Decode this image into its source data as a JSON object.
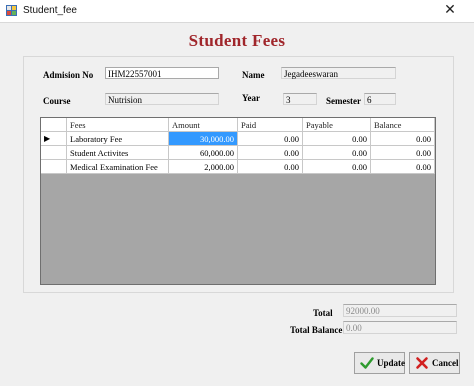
{
  "window": {
    "title": "Student_fee",
    "close_glyph": "✕"
  },
  "heading": "Student Fees",
  "form": {
    "admission_label": "Admision No",
    "admission_value": "IHM22557001",
    "name_label": "Name",
    "name_value": "Jegadeeswaran",
    "course_label": "Course",
    "course_value": "Nutrision",
    "year_label": "Year",
    "year_value": "3",
    "semester_label": "Semester",
    "semester_value": "6"
  },
  "grid": {
    "columns": [
      "Fees",
      "Amount",
      "Paid",
      "Payable",
      "Balance"
    ],
    "current_row_marker": "▶",
    "rows": [
      {
        "fees": "Laboratory Fee",
        "amount": "30,000.00",
        "paid": "0.00",
        "payable": "0.00",
        "balance": "0.00"
      },
      {
        "fees": "Student Activites",
        "amount": "60,000.00",
        "paid": "0.00",
        "payable": "0.00",
        "balance": "0.00"
      },
      {
        "fees": "Medical Examination Fee",
        "amount": "2,000.00",
        "paid": "0.00",
        "payable": "0.00",
        "balance": "0.00"
      }
    ]
  },
  "totals": {
    "total_label": "Total",
    "total_value": "92000.00",
    "balance_label": "Total Balance",
    "balance_value": "0.00"
  },
  "buttons": {
    "update_label": "Update",
    "cancel_label": "Cancel"
  },
  "colors": {
    "heading": "#a0262b",
    "selection": "#3399ff",
    "grid_background": "#a6a6a6"
  }
}
